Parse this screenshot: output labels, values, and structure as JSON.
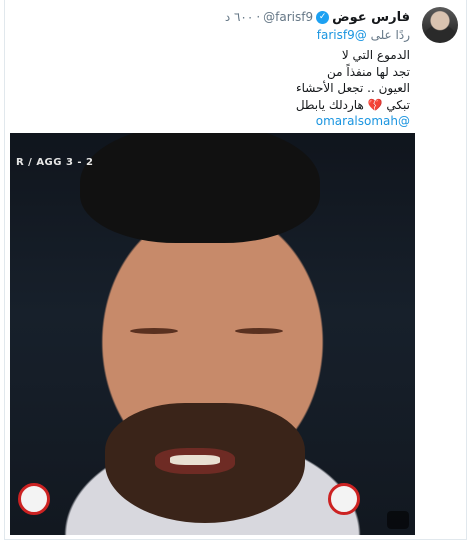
{
  "tweet": {
    "author_name": "فارس عوض",
    "author_handle": "@farisf9",
    "dot": "·",
    "time": "٦٠٠ د",
    "reply_prefix": "ردًا على",
    "reply_to": "@farisf9",
    "lines": [
      "الدموع التي لا",
      "تجد لها منفذاً من",
      "العيون .. تجعل الأحشاء",
      "تبكي",
      "هاردلك يابطل"
    ],
    "mention": "@omaralsomah",
    "heart_emoji": "💔",
    "verified_icon": "✓"
  },
  "media": {
    "score_text": "R / AGG 3 - 2"
  }
}
